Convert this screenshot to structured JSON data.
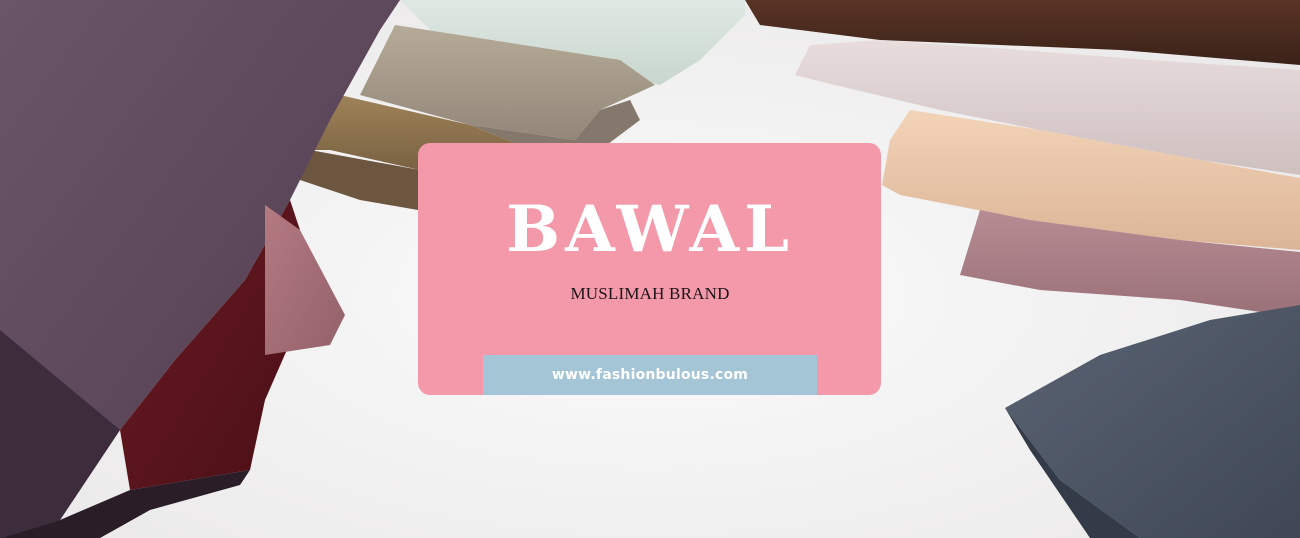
{
  "banner": {
    "title": "BAWAL",
    "subtitle": "MUSLIMAH BRAND",
    "url": "www.fashionbulous.com"
  },
  "colors": {
    "card": "#f399aa",
    "url_bar": "#a4c5d5",
    "title_text": "#ffffff",
    "subtitle_text": "#1c1416",
    "background": "#f2f1f1"
  },
  "scene": {
    "description_icon": "folded-fabric-scarves-photo"
  }
}
